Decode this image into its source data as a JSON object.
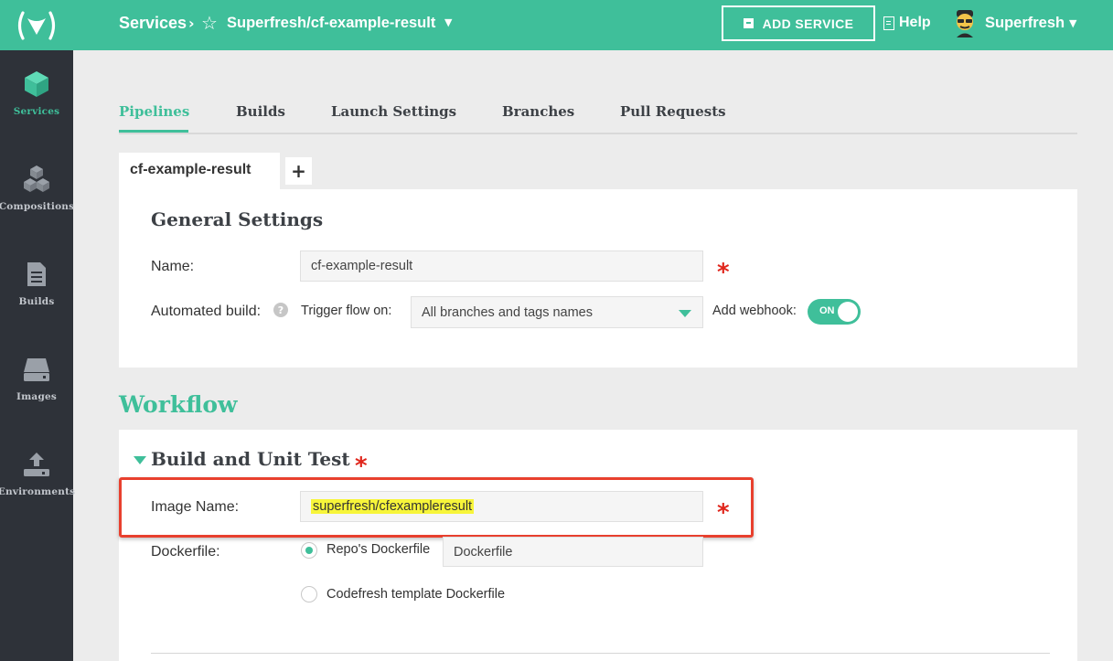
{
  "brand": {
    "accent": "#3fbf9a",
    "sidebar_bg": "#2e3239",
    "required_color": "#e0261c"
  },
  "sidebar": {
    "items": [
      {
        "label": "Services",
        "icon": "cube-icon",
        "active": true
      },
      {
        "label": "Compositions",
        "icon": "cubes-icon",
        "active": false
      },
      {
        "label": "Builds",
        "icon": "document-icon",
        "active": false
      },
      {
        "label": "Images",
        "icon": "server-icon",
        "active": false
      },
      {
        "label": "Environments",
        "icon": "upload-icon",
        "active": false
      }
    ]
  },
  "header": {
    "breadcrumb_root": "Services",
    "breadcrumb_sep": "›",
    "repo": "Superfresh/cf-example-result",
    "add_service_label": "ADD SERVICE",
    "help_label": "Help",
    "user_name": "Superfresh"
  },
  "tabs": [
    {
      "label": "Pipelines",
      "active": true
    },
    {
      "label": "Builds",
      "active": false
    },
    {
      "label": "Launch Settings",
      "active": false
    },
    {
      "label": "Branches",
      "active": false
    },
    {
      "label": "Pull Requests",
      "active": false
    }
  ],
  "pipeline_tab": {
    "label": "cf-example-result",
    "add_label": "+"
  },
  "general": {
    "title": "General Settings",
    "name_label": "Name:",
    "name_value": "cf-example-result",
    "automated_label": "Automated build:",
    "trigger_label": "Trigger flow on:",
    "trigger_value": "All branches and tags names",
    "webhook_label": "Add webhook:",
    "webhook_state": "ON"
  },
  "workflow": {
    "title": "Workflow",
    "step_title": "Build and Unit Test",
    "image_name_label": "Image Name:",
    "image_name_value": "superfresh/cfexampleresult",
    "dockerfile_label": "Dockerfile:",
    "dockerfile_options": [
      {
        "label": "Repo's Dockerfile",
        "selected": true
      },
      {
        "label": "Codefresh template Dockerfile",
        "selected": false
      }
    ],
    "dockerfile_value": "Dockerfile"
  },
  "required_mark": "*"
}
